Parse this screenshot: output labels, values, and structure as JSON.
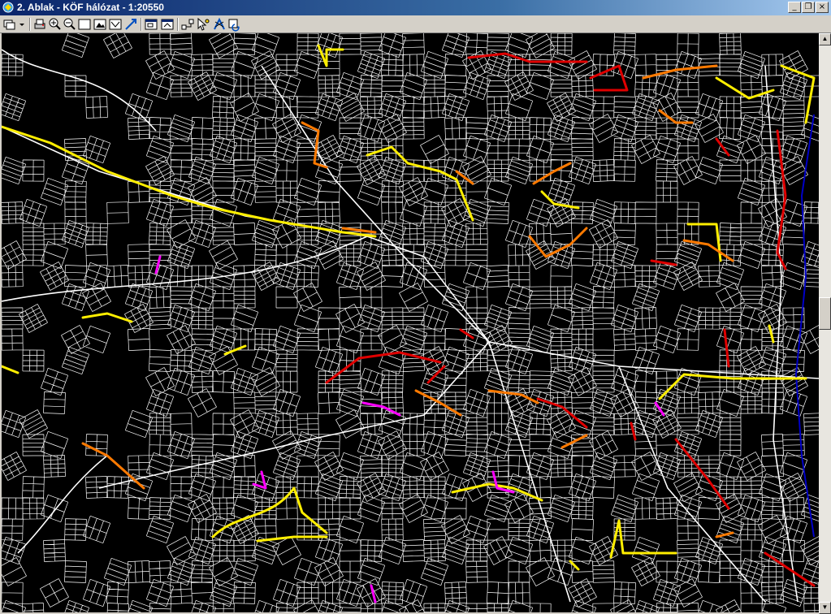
{
  "window": {
    "title": "2. Ablak - KÖF hálózat - 1:20550",
    "minimize_glyph": "_",
    "restore_glyph": "❐",
    "close_glyph": "×"
  },
  "toolbar": {
    "buttons": [
      {
        "name": "layer-dropdown-button",
        "icon": "layers-icon"
      },
      {
        "name": "print-button",
        "icon": "printer-icon"
      },
      {
        "name": "zoom-in-button",
        "icon": "zoom-in-icon"
      },
      {
        "name": "zoom-out-button",
        "icon": "zoom-out-icon"
      },
      {
        "name": "view-full-button",
        "icon": "frame-icon"
      },
      {
        "name": "view-image-button",
        "icon": "image-icon"
      },
      {
        "name": "view-region-button",
        "icon": "region-icon"
      },
      {
        "name": "measure-button",
        "icon": "arrow-icon"
      },
      {
        "name": "window-a-button",
        "icon": "window-icon"
      },
      {
        "name": "window-b-button",
        "icon": "window-icon"
      },
      {
        "name": "network-button",
        "icon": "network-icon"
      },
      {
        "name": "select-tool-button",
        "icon": "cursor-icon"
      },
      {
        "name": "trace-button",
        "icon": "trace-icon"
      },
      {
        "name": "refresh-button",
        "icon": "refresh-icon"
      }
    ]
  },
  "map": {
    "background_color": "#000000",
    "street_color": "#ffffff",
    "layer_colors": {
      "yellow": "#ffee00",
      "orange": "#ff7a00",
      "red": "#e00000",
      "magenta": "#ff00ff",
      "blue": "#0000c8"
    }
  },
  "scrollbar": {
    "up_glyph": "▲",
    "down_glyph": "▼",
    "position_fraction": 0.48
  }
}
